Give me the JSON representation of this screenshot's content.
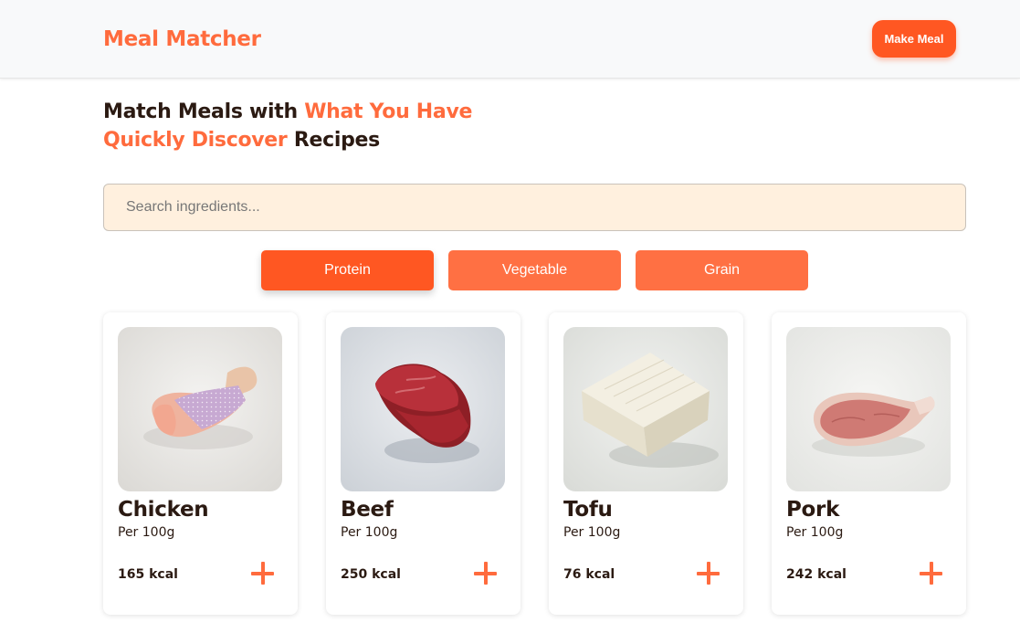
{
  "header": {
    "brand": "Meal Matcher",
    "make_meal_label": "Make Meal"
  },
  "hero": {
    "line1_dark": "Match Meals with ",
    "line1_accent": "What You Have",
    "line2_accent": "Quickly Discover",
    "line2_dark": " Recipes"
  },
  "search": {
    "placeholder": "Search ingredients...",
    "value": ""
  },
  "filters": [
    {
      "label": "Protein",
      "active": true
    },
    {
      "label": "Vegetable",
      "active": false
    },
    {
      "label": "Grain",
      "active": false
    }
  ],
  "ingredients": [
    {
      "name": "Chicken",
      "serving": "Per 100g",
      "kcal": "165 kcal",
      "image": "raw-chicken-drumstick"
    },
    {
      "name": "Beef",
      "serving": "Per 100g",
      "kcal": "250 kcal",
      "image": "raw-beef-steak"
    },
    {
      "name": "Tofu",
      "serving": "Per 100g",
      "kcal": "76 kcal",
      "image": "tofu-block"
    },
    {
      "name": "Pork",
      "serving": "Per 100g",
      "kcal": "242 kcal",
      "image": "raw-pork-chop"
    }
  ],
  "colors": {
    "accent": "#ff6b3d",
    "button": "#ff5722",
    "search_bg": "#fff0de",
    "text_dark": "#2b1a12"
  },
  "icons": {
    "add": "plus-icon"
  }
}
